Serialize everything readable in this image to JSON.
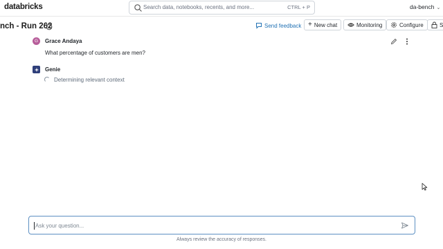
{
  "topbar": {
    "brand": "databricks",
    "search_placeholder": "Search data, notebooks, recents, and more...",
    "search_shortcut": "CTRL + P",
    "workspace": "da-bench"
  },
  "header": {
    "title": "nch - Run 262",
    "send_feedback": "Send feedback",
    "new_chat": "New chat",
    "monitoring": "Monitoring",
    "configure": "Configure",
    "share": "Sh"
  },
  "chat": {
    "user_initial": "G",
    "user_name": "Grace Andaya",
    "user_message": "What percentage of customers are men?",
    "assistant_name": "Genie",
    "assistant_status": "Determining relevant context"
  },
  "composer": {
    "placeholder": "Ask your question...",
    "disclaimer": "Always review the accuracy of responses."
  },
  "colors": {
    "accent": "#2272b4",
    "user_avatar": "#b75d9a",
    "genie_avatar": "#2f3f7a"
  }
}
